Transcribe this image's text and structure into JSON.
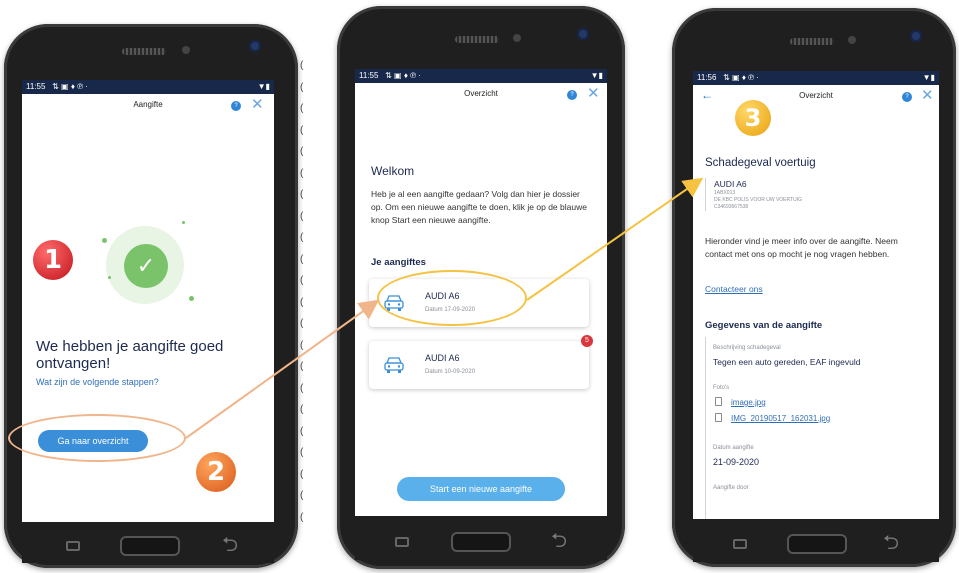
{
  "colors": {
    "accent": "#3a8fd8",
    "navy": "#1d2a50",
    "green": "#7bc36a",
    "orange": "#f0a23a",
    "red_badge": "#d9363e"
  },
  "screen1": {
    "status_time": "11:55",
    "title": "Aangifte",
    "heading": "We hebben je aangifte goed ontvangen!",
    "subheading": "Wat zijn de volgende stappen?",
    "button": "Ga naar overzicht",
    "step_a": "1",
    "step_b": "2"
  },
  "screen2": {
    "status_time": "11:55",
    "title": "Overzicht",
    "welcome": "Welkom",
    "intro": "Heb je al een aangifte gedaan? Volg dan hier je dossier op. Om een nieuwe aangifte te doen, klik je op de blauwe knop Start een nieuwe aangifte.",
    "section": "Je aangiftes",
    "claims": [
      {
        "car": "AUDI A6",
        "date": "Datum 17-09-2020"
      },
      {
        "car": "AUDI A6",
        "date": "Datum 10-09-2020",
        "badge": "5"
      }
    ],
    "button": "Start een nieuwe aangifte"
  },
  "screen3": {
    "status_time": "11:56",
    "title": "Overzicht",
    "step": "3",
    "heading": "Schadegeval voertuig",
    "car": "AUDI A6",
    "plate": "1ABX013",
    "policy": "DE KBC POLIS VOOR UW VOERTUIG",
    "policy_no": "C34693667538",
    "info": "Hieronder vind je meer info over de aangifte. Neem contact met ons op mocht je nog vragen hebben.",
    "contact": "Contacteer ons",
    "section": "Gegevens van de aangifte",
    "desc_label": "Beschrijving schadegeval",
    "desc_value": "Tegen een auto gereden, EAF ingevuld",
    "photos_label": "Foto's",
    "photos": [
      "image.jpg",
      "IMG_20190517_162031.jpg"
    ],
    "date_label": "Datum aangifte",
    "date_value": "21-09-2020",
    "by_label": "Aangifte door"
  },
  "icons": [
    "status-icons",
    "help-icon",
    "close-icon",
    "back-arrow-icon",
    "check-icon",
    "car-icon",
    "file-icon",
    "nav-recent-icon",
    "nav-home-icon",
    "nav-back-icon"
  ]
}
